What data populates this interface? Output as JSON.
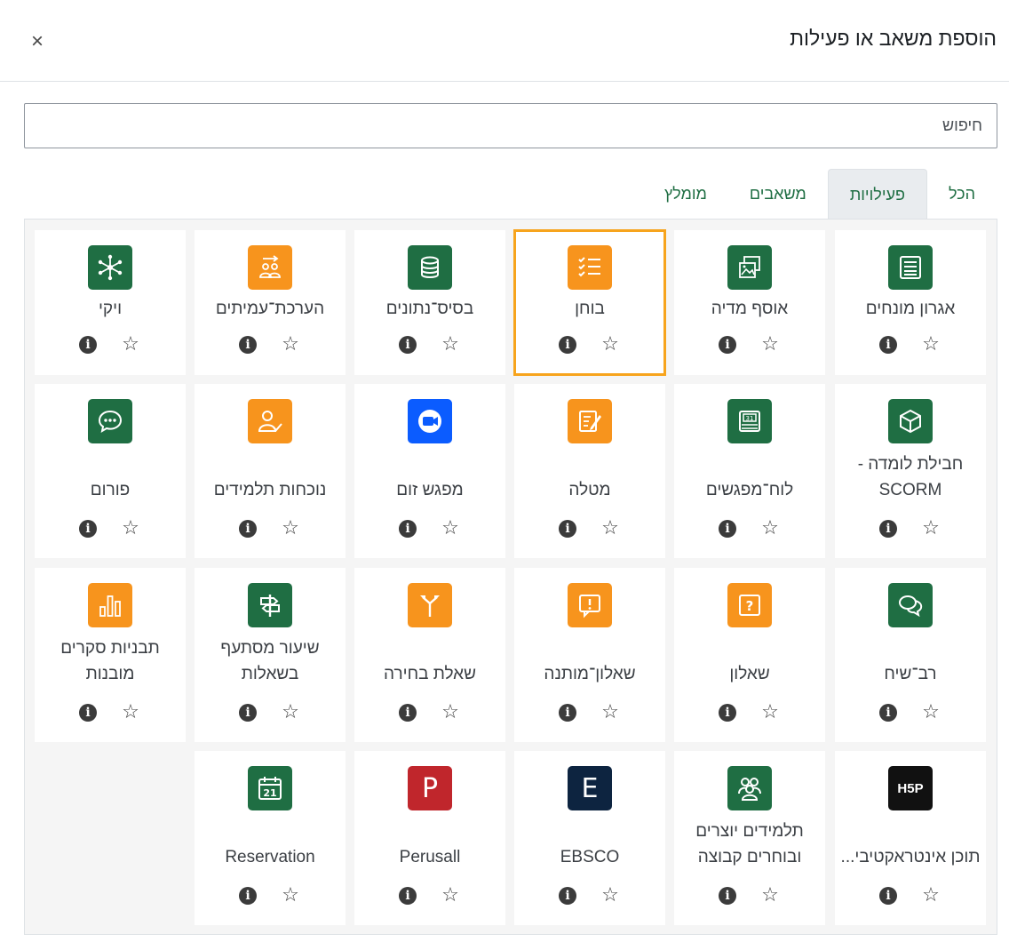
{
  "modal": {
    "title": "הוספת משאב או פעילות",
    "close_glyph": "×"
  },
  "search": {
    "placeholder": "חיפוש"
  },
  "tabs": [
    {
      "label": "הכל",
      "active": false
    },
    {
      "label": "פעילויות",
      "active": true
    },
    {
      "label": "משאבים",
      "active": false
    },
    {
      "label": "מומלץ",
      "active": false
    }
  ],
  "colors": {
    "accent": "#1f6e43",
    "orange": "#f7941d",
    "selection": "#f7a41d"
  },
  "cards": [
    {
      "name": "אגרון מונחים",
      "icon": "glossary-icon",
      "color": "green",
      "row": 0,
      "col": 0
    },
    {
      "name": "אוסף מדיה",
      "icon": "media-gallery-icon",
      "color": "green",
      "row": 0,
      "col": 1
    },
    {
      "name": "בוחן",
      "icon": "quiz-checklist-icon",
      "color": "orange",
      "row": 0,
      "col": 2,
      "selected": true
    },
    {
      "name": "בסיס־נתונים",
      "icon": "database-icon",
      "color": "green",
      "row": 0,
      "col": 3
    },
    {
      "name": "הערכת־עמיתים",
      "icon": "peer-assessment-icon",
      "color": "orange",
      "row": 0,
      "col": 4
    },
    {
      "name": "ויקי",
      "icon": "wiki-network-icon",
      "color": "green",
      "row": 0,
      "col": 5
    },
    {
      "name": "חבילת לומדה - SCORM",
      "icon": "scorm-package-icon",
      "color": "green",
      "row": 1,
      "col": 0
    },
    {
      "name": "לוח־מפגשים",
      "icon": "scheduler-calendar-icon",
      "color": "green",
      "row": 1,
      "col": 1
    },
    {
      "name": "מטלה",
      "icon": "assignment-edit-icon",
      "color": "orange",
      "row": 1,
      "col": 2
    },
    {
      "name": "מפגש זום",
      "icon": "zoom-camera-icon",
      "color": "blue",
      "row": 1,
      "col": 3
    },
    {
      "name": "נוכחות תלמידים",
      "icon": "attendance-user-check-icon",
      "color": "orange",
      "row": 1,
      "col": 4
    },
    {
      "name": "פורום",
      "icon": "forum-chat-icon",
      "color": "green",
      "row": 1,
      "col": 5
    },
    {
      "name": "רב־שיח",
      "icon": "chat-bubbles-icon",
      "color": "green",
      "row": 2,
      "col": 0
    },
    {
      "name": "שאלון",
      "icon": "questionnaire-icon",
      "color": "orange",
      "row": 2,
      "col": 1
    },
    {
      "name": "שאלון־מותנה",
      "icon": "conditional-feedback-icon",
      "color": "orange",
      "row": 2,
      "col": 2
    },
    {
      "name": "שאלת בחירה",
      "icon": "choice-signpost-icon",
      "color": "orange",
      "row": 2,
      "col": 3
    },
    {
      "name": "שיעור מסתעף בשאלות",
      "icon": "lesson-signpost-icon",
      "color": "green",
      "row": 2,
      "col": 4
    },
    {
      "name": "תבניות סקרים מובנות",
      "icon": "survey-bar-chart-icon",
      "color": "orange",
      "row": 2,
      "col": 5
    },
    {
      "name": "תוכן אינטראקטיבי...",
      "icon": "h5p-icon",
      "color": "black",
      "row": 3,
      "col": 0,
      "glyph": "H5P"
    },
    {
      "name": "תלמידים יוצרים ובוחרים קבוצה",
      "icon": "group-choice-icon",
      "color": "green",
      "row": 3,
      "col": 1
    },
    {
      "name": "EBSCO",
      "icon": "ebsco-letter-icon",
      "color": "navy",
      "row": 3,
      "col": 2,
      "glyph": "E"
    },
    {
      "name": "Perusall",
      "icon": "perusall-letter-icon",
      "color": "red",
      "row": 3,
      "col": 3,
      "glyph": "P"
    },
    {
      "name": "Reservation",
      "icon": "reservation-calendar-icon",
      "color": "green",
      "row": 3,
      "col": 4
    }
  ],
  "info_glyph": "i",
  "star_glyph": "☆"
}
